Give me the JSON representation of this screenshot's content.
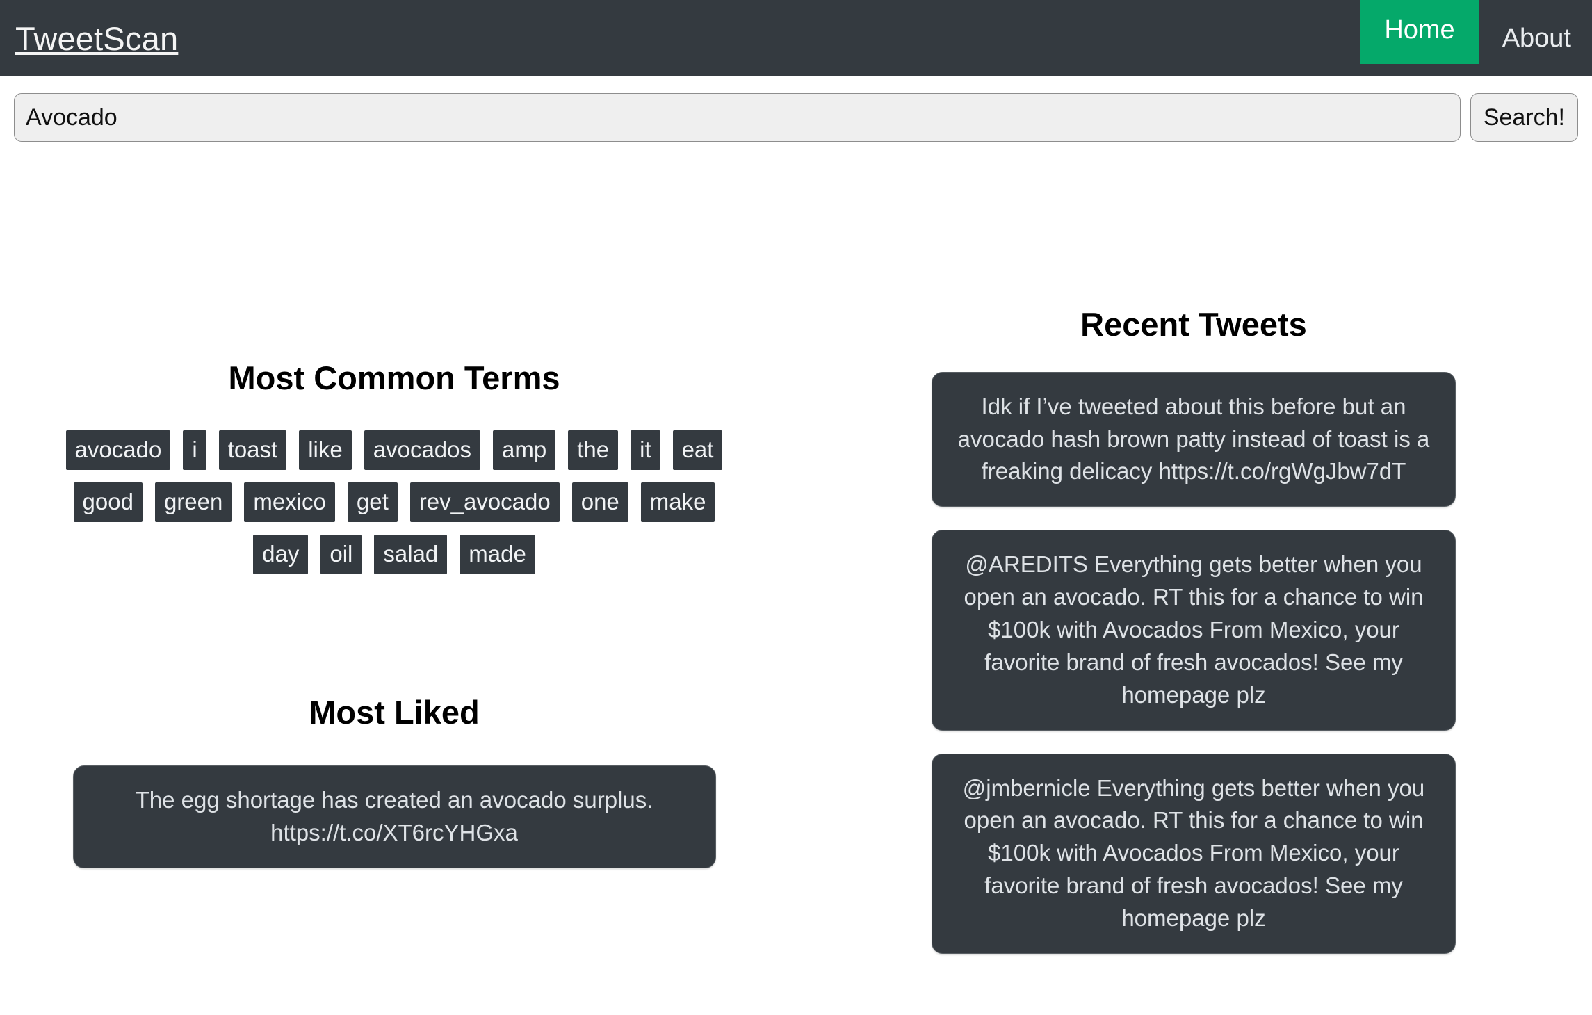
{
  "navbar": {
    "brand": "TweetScan",
    "links": [
      {
        "label": "Home",
        "active": true
      },
      {
        "label": "About",
        "active": false
      }
    ]
  },
  "search": {
    "value": "Avocado",
    "placeholder": "Search",
    "button_label": "Search!"
  },
  "colors": {
    "navbar_bg": "#343a40",
    "nav_active_bg": "#05a96a",
    "card_bg": "#343a40",
    "card_text": "#dee2e6",
    "page_bg": "#ffffff",
    "input_bg": "#efefef"
  },
  "common_terms": {
    "title": "Most Common Terms",
    "terms": [
      "avocado",
      "i",
      "toast",
      "like",
      "avocados",
      "amp",
      "the",
      "it",
      "eat",
      "good",
      "green",
      "mexico",
      "get",
      "rev_avocado",
      "one",
      "make",
      "day",
      "oil",
      "salad",
      "made"
    ]
  },
  "most_liked": {
    "title": "Most Liked",
    "tweet": "The egg shortage has created an avocado surplus. https://t.co/XT6rcYHGxa"
  },
  "recent_tweets": {
    "title": "Recent Tweets",
    "tweets": [
      "Idk if I’ve tweeted about this before but an avocado hash brown patty instead of toast is a freaking delicacy https://t.co/rgWgJbw7dT",
      "@AREDITS Everything gets better when you open an avocado. RT this for a chance to win $100k with Avocados From Mexico, your favorite brand of fresh avocados! See my homepage plz",
      "@jmbernicle Everything gets better when you open an avocado. RT this for a chance to win $100k with Avocados From Mexico, your favorite brand of fresh avocados! See my homepage plz"
    ]
  }
}
